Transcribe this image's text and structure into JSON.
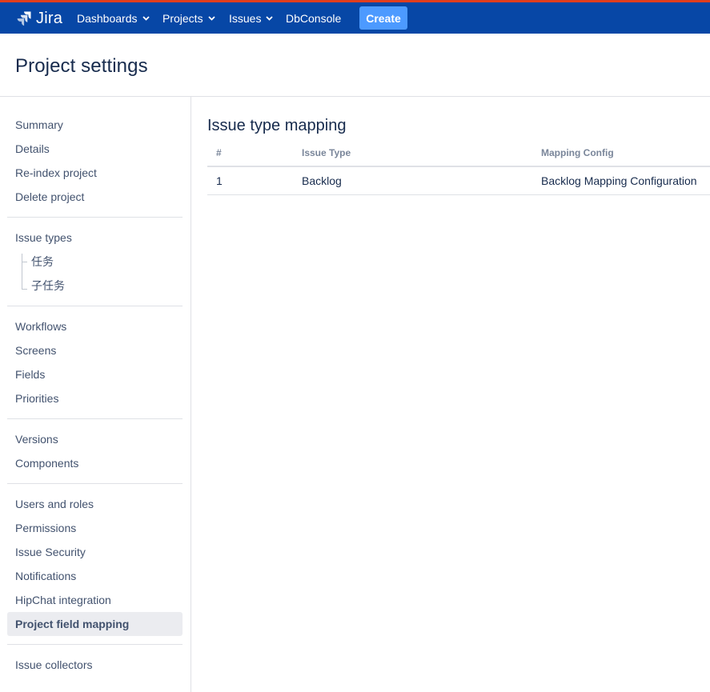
{
  "topnav": {
    "logo_text": "Jira",
    "items": [
      {
        "label": "Dashboards",
        "has_dropdown": true
      },
      {
        "label": "Projects",
        "has_dropdown": true
      },
      {
        "label": "Issues",
        "has_dropdown": true
      },
      {
        "label": "DbConsole",
        "has_dropdown": false
      }
    ],
    "create_label": "Create",
    "bar_color": "#0747a6",
    "accent_color": "#e03e1e",
    "create_color": "#4c9aff"
  },
  "header": {
    "title": "Project settings"
  },
  "sidebar": {
    "groups": [
      {
        "items": [
          "Summary",
          "Details",
          "Re-index project",
          "Delete project"
        ]
      },
      {
        "items": [
          "Issue types"
        ],
        "subitems": [
          "任务",
          "子任务"
        ]
      },
      {
        "items": [
          "Workflows",
          "Screens",
          "Fields",
          "Priorities"
        ]
      },
      {
        "items": [
          "Versions",
          "Components"
        ]
      },
      {
        "items": [
          "Users and roles",
          "Permissions",
          "Issue Security",
          "Notifications",
          "HipChat integration",
          "Project field mapping"
        ]
      },
      {
        "items": [
          "Issue collectors"
        ]
      }
    ],
    "active_item": "Project field mapping"
  },
  "main": {
    "section_title": "Issue type mapping",
    "table": {
      "columns": [
        "#",
        "Issue Type",
        "Mapping Config"
      ],
      "rows": [
        [
          "1",
          "Backlog",
          "Backlog Mapping Configuration"
        ]
      ]
    }
  }
}
